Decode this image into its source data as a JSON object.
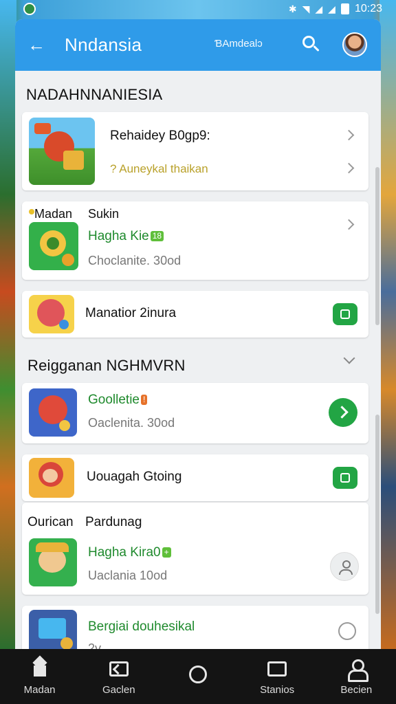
{
  "status_bar": {
    "time": "10:23"
  },
  "app_bar": {
    "title": "Nndansia",
    "subtitle": "ƁAmdealɔ"
  },
  "sections": {
    "first_title": "NADAHNNANIESIA",
    "second_title": "Reigganan NGHMVRN"
  },
  "cards": {
    "c1": {
      "title": "Rehaidey B0gp9:",
      "subtitle": "? Auneykal thaikan"
    },
    "c2": {
      "heading": "Madan",
      "heading2": "Sukin",
      "name": "Hagha Kie",
      "badge": "18",
      "meta": "Choclanite. 30od"
    },
    "c3": {
      "title": "Manatior 2inura"
    },
    "c4": {
      "name": "Goolletie",
      "badge": "!",
      "meta": "Oaclenita. 30od"
    },
    "c5": {
      "title": "Uouagah Gtoing"
    },
    "c6": {
      "heading": "Ourican",
      "heading2": "Pardunag",
      "name": "Hagha Kira0",
      "badge": "+",
      "meta": "Uaclania 10od"
    },
    "c7": {
      "title": "Bergiai douhesikal",
      "meta": "2v"
    }
  },
  "bottom_nav": [
    {
      "label": "Madan",
      "icon": "home-icon"
    },
    {
      "label": "Gaclen",
      "icon": "back-icon"
    },
    {
      "label": "",
      "icon": "circle-icon"
    },
    {
      "label": "Stanios",
      "icon": "tv-icon"
    },
    {
      "label": "Becien",
      "icon": "user-icon"
    }
  ],
  "colors": {
    "accent": "#2f9be9",
    "green": "#22a544",
    "nav_bg": "#141414"
  }
}
